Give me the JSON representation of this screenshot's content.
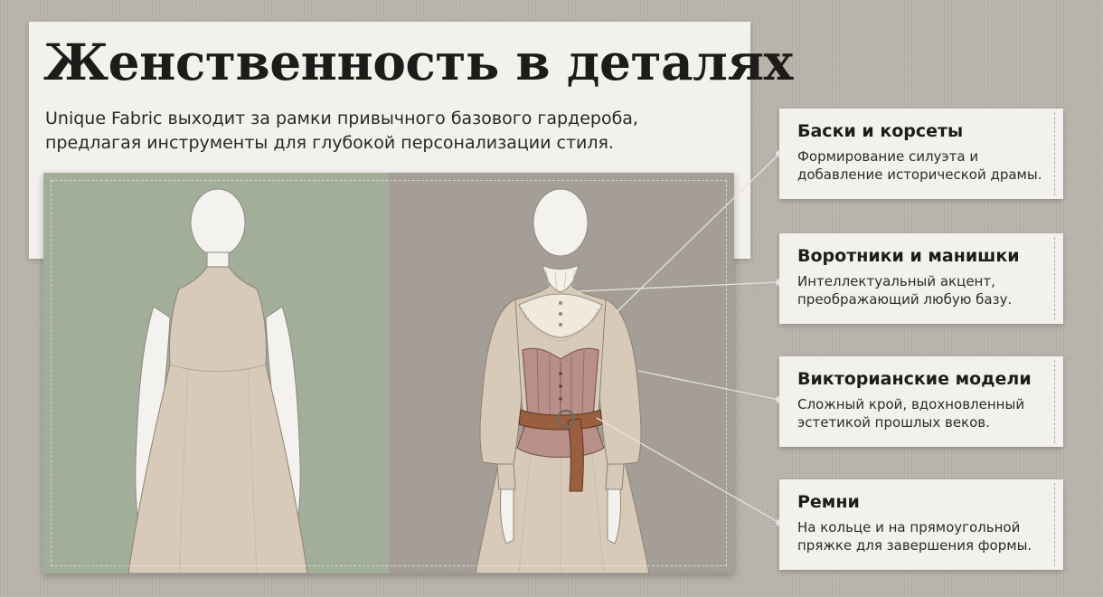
{
  "header": {
    "title": "Женственность в деталях",
    "subtitle_lines": [
      "Unique Fabric выходит за рамки привычного базового гардероба,",
      "предлагая инструменты для глубокой персонализации стиля."
    ]
  },
  "colors": {
    "background": "#b9b4ab",
    "card": "#f3f1ed",
    "left_panel": "#a2ae9a",
    "right_panel": "#a59e97",
    "dress": "#d8cab8",
    "corset": "#b99089",
    "belt": "#9a5f3f"
  },
  "tags": [
    {
      "title": "Баски и корсеты",
      "desc": [
        "Формирование силуэта и",
        "добавление исторической драмы."
      ]
    },
    {
      "title": "Воротники и манишки",
      "desc": [
        "Интеллектуальный акцент,",
        "преображающий любую базу."
      ]
    },
    {
      "title": "Викторианские модели",
      "desc": [
        "Сложный крой, вдохновленный",
        "эстетикой прошлых веков."
      ]
    },
    {
      "title": "Ремни",
      "desc": [
        "На кольце и на прямоугольной",
        "пряжке для завершения формы."
      ]
    }
  ]
}
